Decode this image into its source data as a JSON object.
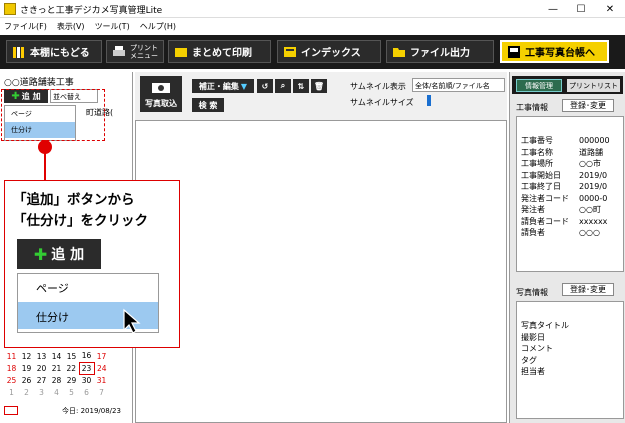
{
  "window": {
    "title": "さきっと工事デジカメ写真管理Lite",
    "min": "—",
    "max": "☐",
    "close": "✕"
  },
  "menu": [
    "ファイル(F)",
    "表示(V)",
    "ツール(T)",
    "ヘルプ(H)"
  ],
  "toolbar": {
    "back": "本棚にもどる",
    "print_menu": "プリント\nメニュー",
    "batch_print": "まとめて印刷",
    "index": "インデックス",
    "file_output": "ファイル出力",
    "ledger": "工事写真台帳へ"
  },
  "left": {
    "project": "○○道路舗装工事",
    "add": "追 加",
    "sort": "並べ替え",
    "tree_item": "町道路(",
    "dropdown": [
      "ページ",
      "仕分け"
    ],
    "today": "今日: 2019/08/23"
  },
  "calendar": {
    "rows": [
      [
        "11",
        "12",
        "13",
        "14",
        "15",
        "16",
        "17"
      ],
      [
        "18",
        "19",
        "20",
        "21",
        "22",
        "23",
        "24"
      ],
      [
        "25",
        "26",
        "27",
        "28",
        "29",
        "30",
        "31"
      ],
      [
        "1",
        "2",
        "3",
        "4",
        "5",
        "6",
        "7"
      ]
    ]
  },
  "mid": {
    "photo_import": "写真取込",
    "correct_edit": "補正・編集",
    "search": "検 索",
    "thumb_display_label": "サムネイル表示",
    "thumb_display_value": "全体/名前順/ファイル名",
    "thumb_size_label": "サムネイルサイズ"
  },
  "right": {
    "tab_info": "情報管理",
    "tab_print": "プリントリスト",
    "project_info_label": "工事情報",
    "register_btn": "登録･変更",
    "project_fields": [
      {
        "k": "工事番号",
        "v": "000000"
      },
      {
        "k": "工事名称",
        "v": "道路舗"
      },
      {
        "k": "工事場所",
        "v": "○○市"
      },
      {
        "k": "工事開始日",
        "v": "2019/0"
      },
      {
        "k": "工事終了日",
        "v": "2019/0"
      },
      {
        "k": "発注者コード",
        "v": "0000-0"
      },
      {
        "k": "発注者",
        "v": "○○町"
      },
      {
        "k": "請負者コード",
        "v": "xxxxxx"
      },
      {
        "k": "請負者",
        "v": "○○○"
      }
    ],
    "photo_info_label": "写真情報",
    "photo_register_btn": "登録･変更",
    "photo_fields": [
      "写真タイトル",
      "撮影日",
      "コメント",
      "タグ",
      "担当者"
    ]
  },
  "callout": {
    "line1": "「追加」ボタンから",
    "line2": "「仕分け」をクリック",
    "add_label": "追 加",
    "menu": [
      "ページ",
      "仕分け"
    ]
  }
}
